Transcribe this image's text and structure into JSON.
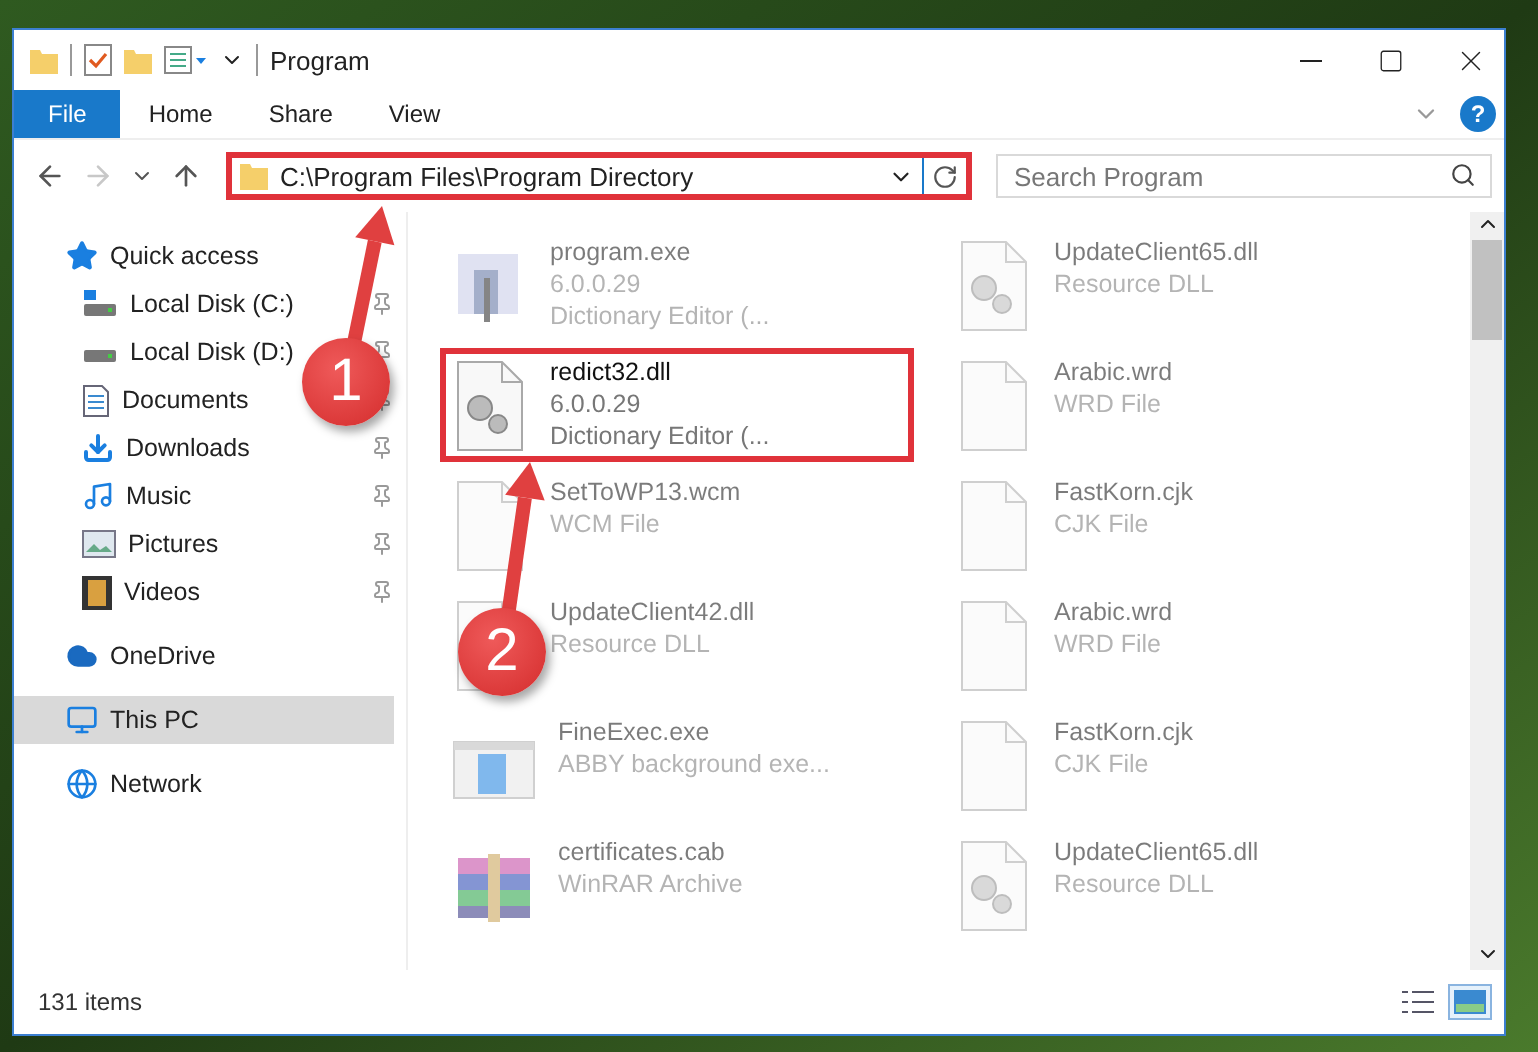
{
  "window": {
    "title": "Program"
  },
  "ribbon": {
    "tabs": [
      {
        "label": "File",
        "selected": true
      },
      {
        "label": "Home",
        "selected": false
      },
      {
        "label": "Share",
        "selected": false
      },
      {
        "label": "View",
        "selected": false
      }
    ],
    "help": "?"
  },
  "address_bar": {
    "path": "C:\\Program Files\\Program Directory",
    "highlighted": true,
    "forward_disabled": true
  },
  "search": {
    "placeholder": "Search Program"
  },
  "sidebar": {
    "items": [
      {
        "label": "Quick access",
        "kind": "star",
        "selected": false,
        "children": [
          {
            "label": "Local Disk (C:)",
            "kind": "drive-win",
            "pinned": true,
            "selected": false
          },
          {
            "label": "Local Disk (D:)",
            "kind": "drive",
            "pinned": true,
            "selected": false
          },
          {
            "label": "Documents",
            "kind": "documents",
            "pinned": true,
            "selected": false
          },
          {
            "label": "Downloads",
            "kind": "downloads",
            "pinned": true,
            "selected": false
          },
          {
            "label": "Music",
            "kind": "music",
            "pinned": true,
            "selected": false
          },
          {
            "label": "Pictures",
            "kind": "pictures",
            "pinned": true,
            "selected": false
          },
          {
            "label": "Videos",
            "kind": "videos",
            "pinned": true,
            "selected": false
          }
        ]
      },
      {
        "label": "OneDrive",
        "kind": "cloud",
        "selected": false
      },
      {
        "label": "This PC",
        "kind": "pc",
        "selected": true
      },
      {
        "label": "Network",
        "kind": "network",
        "selected": false
      }
    ]
  },
  "files": [
    {
      "name": "program.exe",
      "details": [
        "6.0.0.29",
        "Dictionary Editor (..."
      ],
      "kind": "program",
      "blurred": true,
      "highlighted": false
    },
    {
      "name": "UpdateClient65.dll",
      "details": [
        "Resource DLL"
      ],
      "kind": "dll",
      "blurred": true,
      "highlighted": false
    },
    {
      "name": "redict32.dll",
      "details": [
        "6.0.0.29",
        "Dictionary Editor (..."
      ],
      "kind": "dll",
      "blurred": false,
      "highlighted": true
    },
    {
      "name": "Arabic.wrd",
      "details": [
        "WRD File"
      ],
      "kind": "blank",
      "blurred": true,
      "highlighted": false
    },
    {
      "name": "SetToWP13.wcm",
      "details": [
        "WCM File"
      ],
      "kind": "blank",
      "blurred": true,
      "highlighted": false
    },
    {
      "name": "FastKorn.cjk",
      "details": [
        "CJK File"
      ],
      "kind": "blank",
      "blurred": true,
      "highlighted": false
    },
    {
      "name": "UpdateClient42.dll",
      "details": [
        "Resource DLL"
      ],
      "kind": "dll",
      "blurred": true,
      "highlighted": false
    },
    {
      "name": "Arabic.wrd",
      "details": [
        "WRD File"
      ],
      "kind": "blank",
      "blurred": true,
      "highlighted": false
    },
    {
      "name": "FineExec.exe",
      "details": [
        "ABBY background exe..."
      ],
      "kind": "window",
      "blurred": true,
      "highlighted": false
    },
    {
      "name": "FastKorn.cjk",
      "details": [
        "CJK File"
      ],
      "kind": "blank",
      "blurred": true,
      "highlighted": false
    },
    {
      "name": "certificates.cab",
      "details": [
        "WinRAR Archive"
      ],
      "kind": "archive",
      "blurred": true,
      "highlighted": false
    },
    {
      "name": "UpdateClient65.dll",
      "details": [
        "Resource DLL"
      ],
      "kind": "dll",
      "blurred": true,
      "highlighted": false
    }
  ],
  "status_bar": {
    "count": "131 items",
    "views": [
      {
        "kind": "details",
        "selected": false
      },
      {
        "kind": "large-icons",
        "selected": true
      }
    ]
  },
  "annotations": [
    {
      "label": "1"
    },
    {
      "label": "2"
    }
  ]
}
